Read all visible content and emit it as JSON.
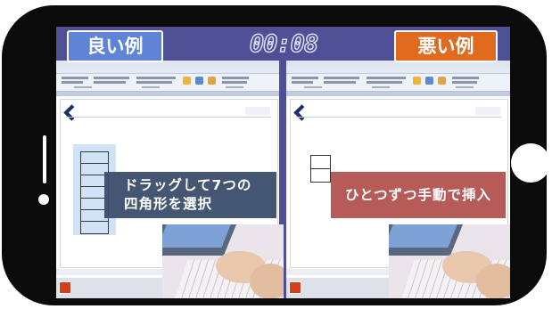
{
  "good_label": "良い例",
  "bad_label": "悪い例",
  "timer": "00:08",
  "good_caption": [
    "ドラッグして7つの",
    "四角形を選択"
  ],
  "bad_caption": "ひとつずつ手動で挿入",
  "colors": {
    "screen_bg": "#4e4f94",
    "good_badge": "#5f84d6",
    "bad_badge": "#e06a1e",
    "good_caption_bg": "#3c4e6b",
    "bad_caption_bg": "#b55553"
  }
}
